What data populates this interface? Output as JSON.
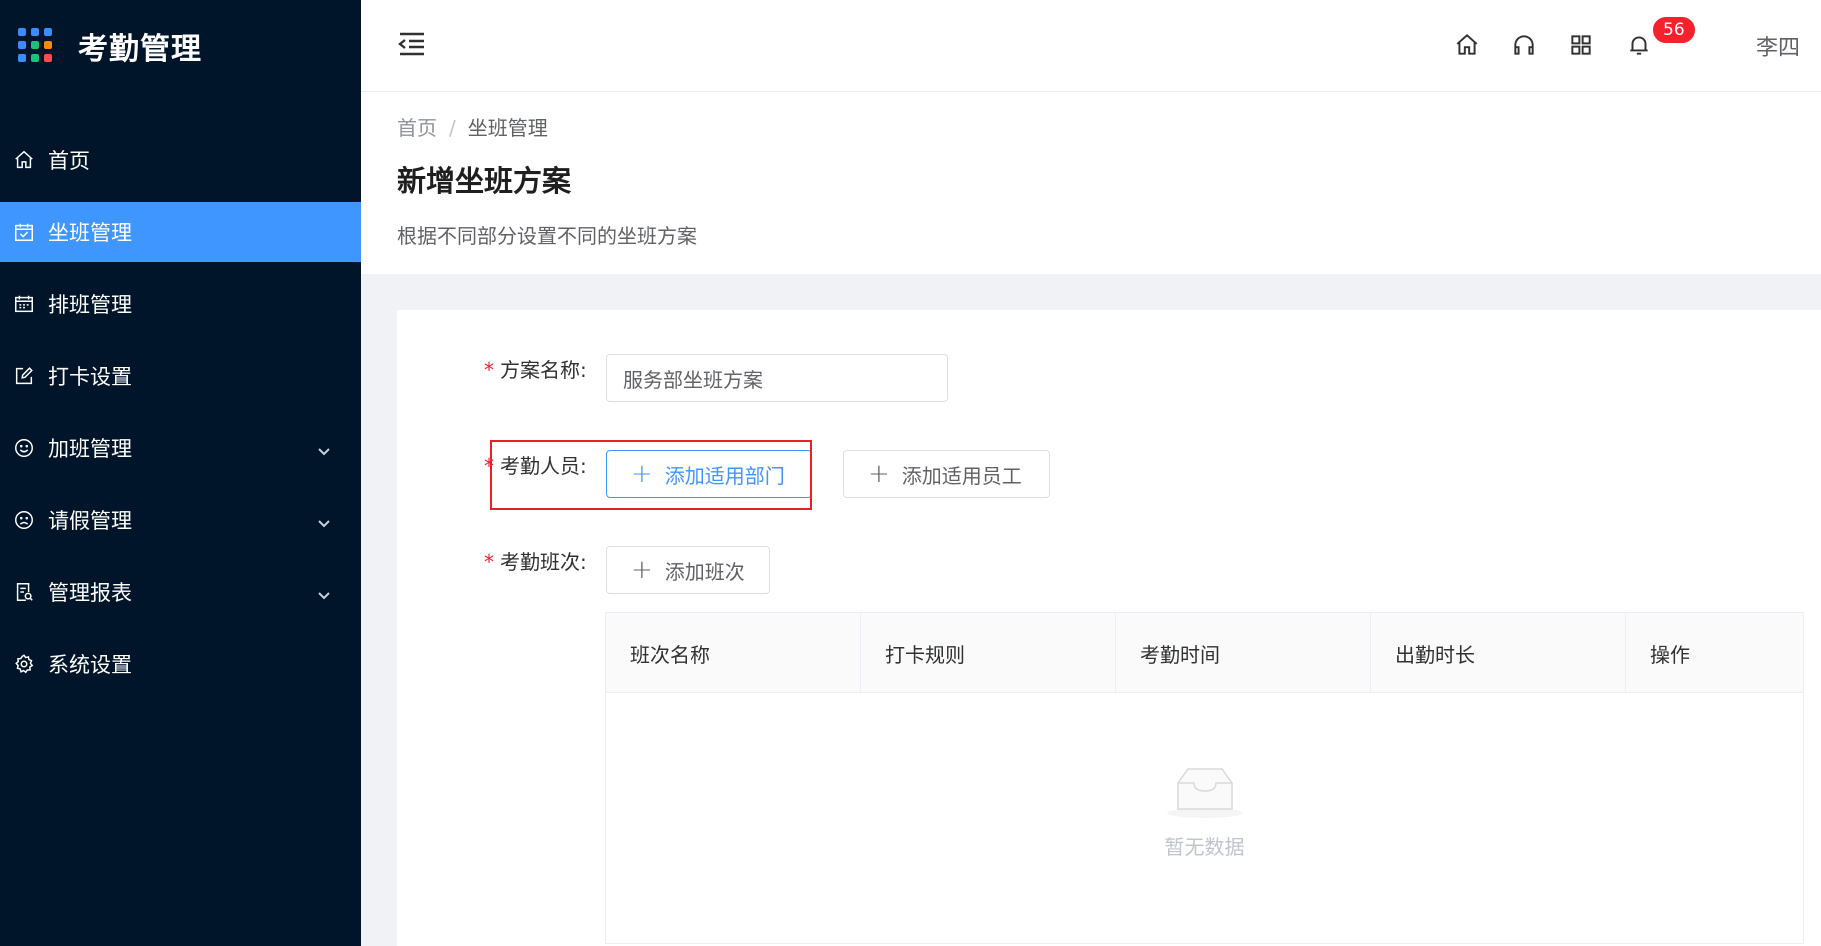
{
  "app": {
    "title": "考勤管理"
  },
  "sidebar": {
    "items": [
      {
        "label": "首页",
        "icon": "home-icon",
        "active": false,
        "expandable": false
      },
      {
        "label": "坐班管理",
        "icon": "calendar-check-icon",
        "active": true,
        "expandable": false
      },
      {
        "label": "排班管理",
        "icon": "schedule-icon",
        "active": false,
        "expandable": false
      },
      {
        "label": "打卡设置",
        "icon": "edit-icon",
        "active": false,
        "expandable": false
      },
      {
        "label": "加班管理",
        "icon": "smile-icon",
        "active": false,
        "expandable": true
      },
      {
        "label": "请假管理",
        "icon": "frown-icon",
        "active": false,
        "expandable": true
      },
      {
        "label": "管理报表",
        "icon": "report-icon",
        "active": false,
        "expandable": true
      },
      {
        "label": "系统设置",
        "icon": "gear-icon",
        "active": false,
        "expandable": false
      }
    ]
  },
  "header": {
    "notifications": "56",
    "user": "李四"
  },
  "breadcrumb": {
    "home": "首页",
    "separator": "/",
    "current": "坐班管理"
  },
  "page": {
    "title": "新增坐班方案",
    "description": "根据不同部分设置不同的坐班方案"
  },
  "form": {
    "required_mark": "*",
    "plan_name_label": "方案名称:",
    "plan_name_value": "服务部坐班方案",
    "staff_label": "考勤人员:",
    "add_department": "添加适用部门",
    "add_employee": "添加适用员工",
    "shift_label": "考勤班次:",
    "add_shift": "添加班次"
  },
  "table": {
    "columns": [
      "班次名称",
      "打卡规则",
      "考勤时间",
      "出勤时长",
      "操作"
    ],
    "empty_text": "暂无数据"
  },
  "colors": {
    "sidebar_bg": "#001529",
    "active_menu": "#4096ff",
    "badge": "#f5222d",
    "highlight": "#e5202b"
  }
}
